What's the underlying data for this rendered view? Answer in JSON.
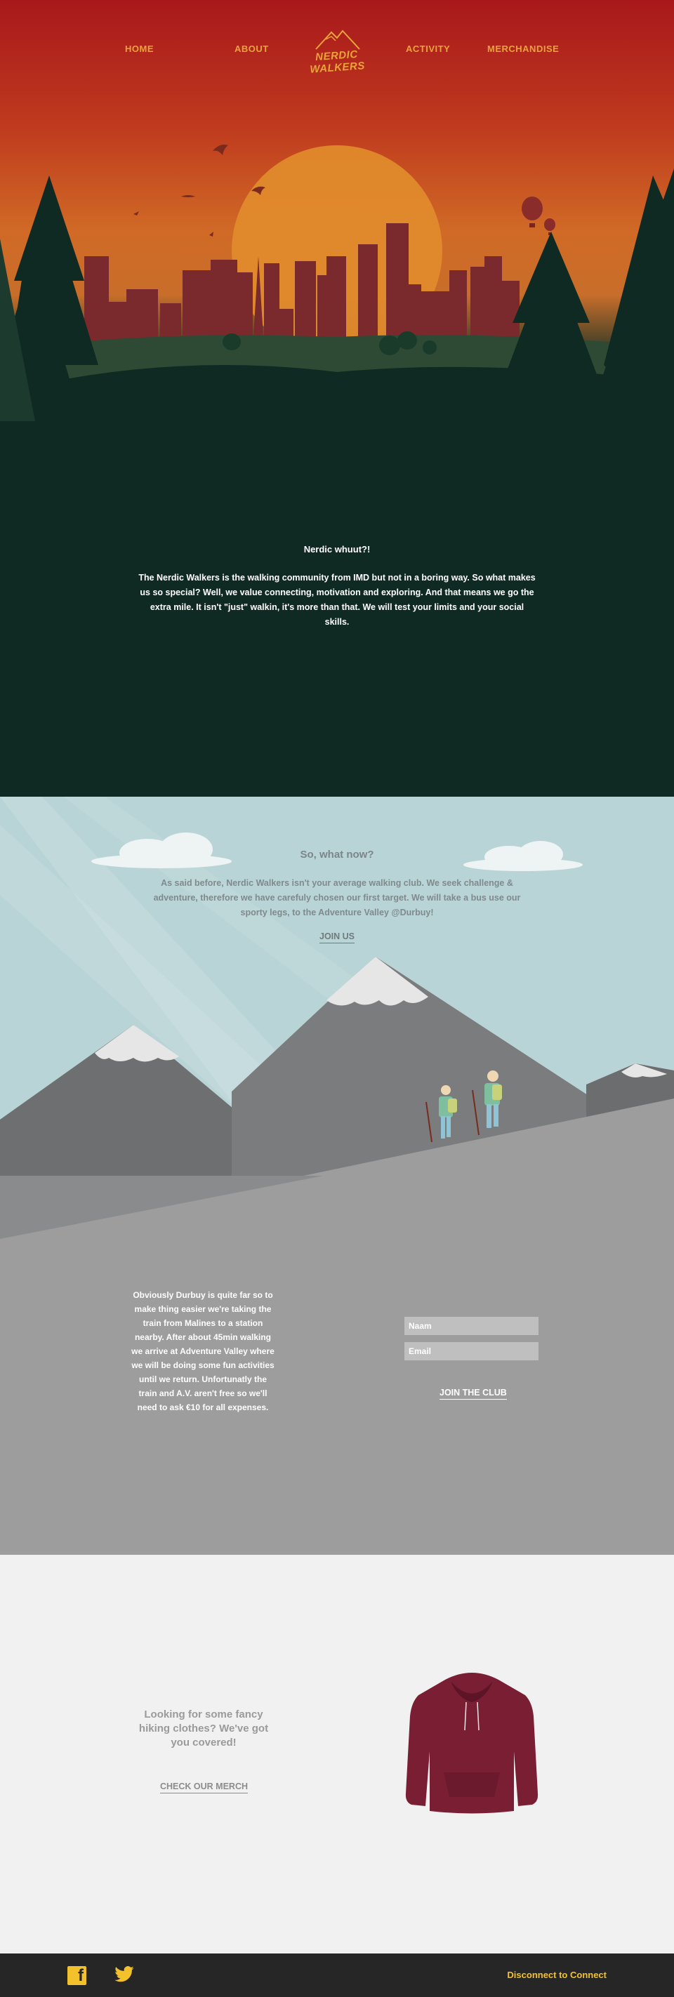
{
  "nav": {
    "home": "HOME",
    "about": "ABOUT",
    "activity": "ACTIVITY",
    "merchandise": "MERCHANDISE",
    "logo_text": "NERDIC WALKERS"
  },
  "hero": {
    "title": "Nerdic whuut?!",
    "text": "The Nerdic Walkers is the walking community from IMD but not in a boring way. So what makes us so special? Well, we value connecting, motivation and exploring. And that means we go the extra mile. It isn't \"just\" walkin, it's more than that. We will test your limits and your social skills."
  },
  "activity": {
    "title": "So, what now?",
    "text": "As said before, Nerdic Walkers isn't your average walking club. We seek challenge & adventure, therefore we have carefuly chosen our first target. We will take a bus use our sporty legs, to the Adventure Valley @Durbuy!",
    "join_us": "JOIN US",
    "details": "Obviously Durbuy is quite far so to make thing easier we're taking the train from Malines to a station nearby. After about 45min walking we arrive at Adventure Valley where we will be doing some fun activities until we return. Unfortunatly the train and A.V. aren't free so we'll need to ask €10 for all expenses.",
    "name_placeholder": "Naam",
    "email_placeholder": "Email",
    "join_club": "JOIN THE CLUB"
  },
  "merch": {
    "text": "Looking for some fancy hiking clothes? We've got you covered!",
    "link": "CHECK OUR MERCH"
  },
  "footer": {
    "facebook_icon": "facebook-icon",
    "twitter_icon": "twitter-icon",
    "disconnect": "Disconnect to Connect"
  },
  "colors": {
    "accent": "#e8a43a",
    "footer_accent": "#f2c12c",
    "hoodie": "#7a1f33"
  }
}
